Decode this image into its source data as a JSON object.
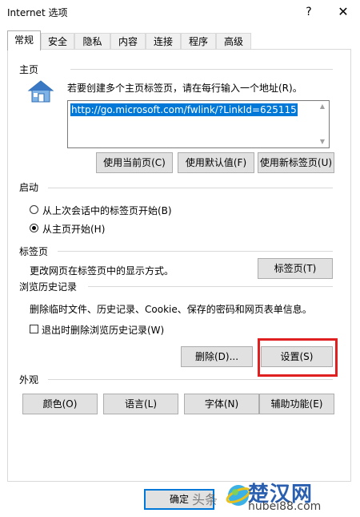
{
  "window": {
    "title": "Internet 选项",
    "help_glyph": "?",
    "close_glyph": "✕"
  },
  "tabs": [
    "常规",
    "安全",
    "隐私",
    "内容",
    "连接",
    "程序",
    "高级"
  ],
  "home": {
    "label": "主页",
    "instruction": "若要创建多个主页标签页，请在每行输入一个地址(R)。",
    "url": "http://go.microsoft.com/fwlink/?LinkId=625115",
    "btn_current": "使用当前页(C)",
    "btn_default": "使用默认值(F)",
    "btn_newtab": "使用新标签页(U)"
  },
  "startup": {
    "label": "启动",
    "option_last": "从上次会话中的标签页开始(B)",
    "option_home": "从主页开始(H)",
    "selected": "home"
  },
  "tabs_section": {
    "label": "标签页",
    "desc": "更改网页在标签页中的显示方式。",
    "btn": "标签页(T)"
  },
  "history": {
    "label": "浏览历史记录",
    "desc": "删除临时文件、历史记录、Cookie、保存的密码和网页表单信息。",
    "checkbox": "退出时删除浏览历史记录(W)",
    "checked": false,
    "btn_delete": "删除(D)...",
    "btn_settings": "设置(S)"
  },
  "appearance": {
    "label": "外观",
    "btn_colors": "颜色(O)",
    "btn_languages": "语言(L)",
    "btn_fonts": "字体(N)",
    "btn_accessibility": "辅助功能(E)"
  },
  "footer": {
    "ok": "确定"
  },
  "watermark": {
    "toutiao": "头条",
    "brand": "楚汉网",
    "url": "hubei88.com"
  },
  "colors": {
    "accent": "#0078d7",
    "highlight": "#e02020"
  }
}
